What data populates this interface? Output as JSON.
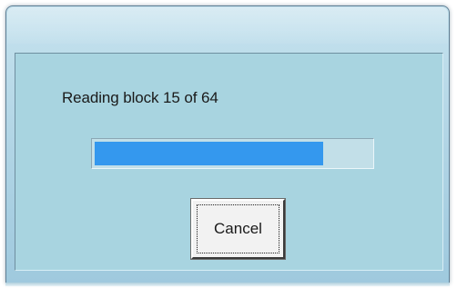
{
  "dialog": {
    "status_text": "Reading block 15 of 64",
    "progress": {
      "current_block": 15,
      "total_blocks": 64,
      "fill_fraction": 0.83
    },
    "cancel_label": "Cancel"
  },
  "colors": {
    "client_background": "#a8d4e0",
    "progress_fill": "#3498ee",
    "progress_track": "#c2dfe8",
    "button_face": "#f2f2f2"
  }
}
